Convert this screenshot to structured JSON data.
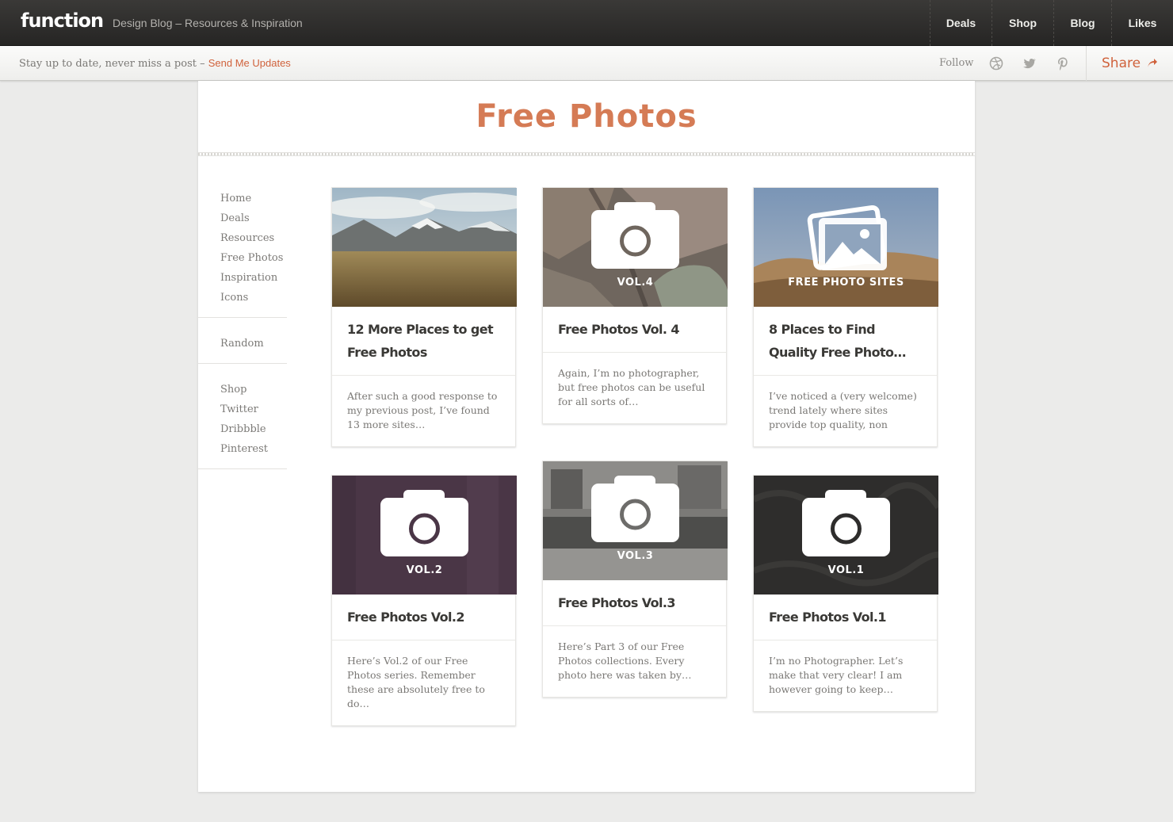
{
  "header": {
    "logo": "function",
    "tagline": "Design Blog – Resources & Inspiration",
    "nav": [
      "Deals",
      "Shop",
      "Blog",
      "Likes"
    ]
  },
  "subbar": {
    "message": "Stay up to date, never miss a post –",
    "cta": "Send Me Updates",
    "follow": "Follow",
    "social_icons": [
      "dribbble-icon",
      "twitter-icon",
      "pinterest-icon"
    ],
    "share": "Share"
  },
  "page": {
    "title": "Free Photos"
  },
  "sidebar": {
    "group1": [
      "Home",
      "Deals",
      "Resources",
      "Free Photos",
      "Inspiration",
      "Icons"
    ],
    "group2": [
      "Random"
    ],
    "group3": [
      "Shop",
      "Twitter",
      "Dribbble",
      "Pinterest"
    ]
  },
  "posts": [
    {
      "title": "12 More Places to get Free Photos",
      "excerpt": "After such a good response to my previous post, I’ve found 13 more sites…",
      "thumb_label": ""
    },
    {
      "title": "Free Photos Vol. 4",
      "excerpt": "Again, I’m no photographer, but free photos can be useful for all sorts of…",
      "thumb_label": "VOL.4"
    },
    {
      "title": "8 Places to Find Quality Free Photo…",
      "excerpt": "I’ve noticed a (very welcome) trend lately where sites provide top quality, non",
      "thumb_label": "FREE PHOTO SITES"
    },
    {
      "title": "Free Photos Vol.2",
      "excerpt": "Here’s Vol.2 of our Free Photos series. Remember these are absolutely free to do…",
      "thumb_label": "VOL.2"
    },
    {
      "title": "Free Photos Vol.3",
      "excerpt": "Here’s Part 3 of our Free Photos collections. Every photo here was taken by…",
      "thumb_label": "VOL.3"
    },
    {
      "title": "Free Photos Vol.1",
      "excerpt": "I’m no Photographer. Let’s make that very clear! I am however going to keep…",
      "thumb_label": "VOL.1"
    }
  ],
  "colors": {
    "accent": "#d0623c",
    "title": "#d57b55",
    "topbar": "#2e2d2b"
  }
}
